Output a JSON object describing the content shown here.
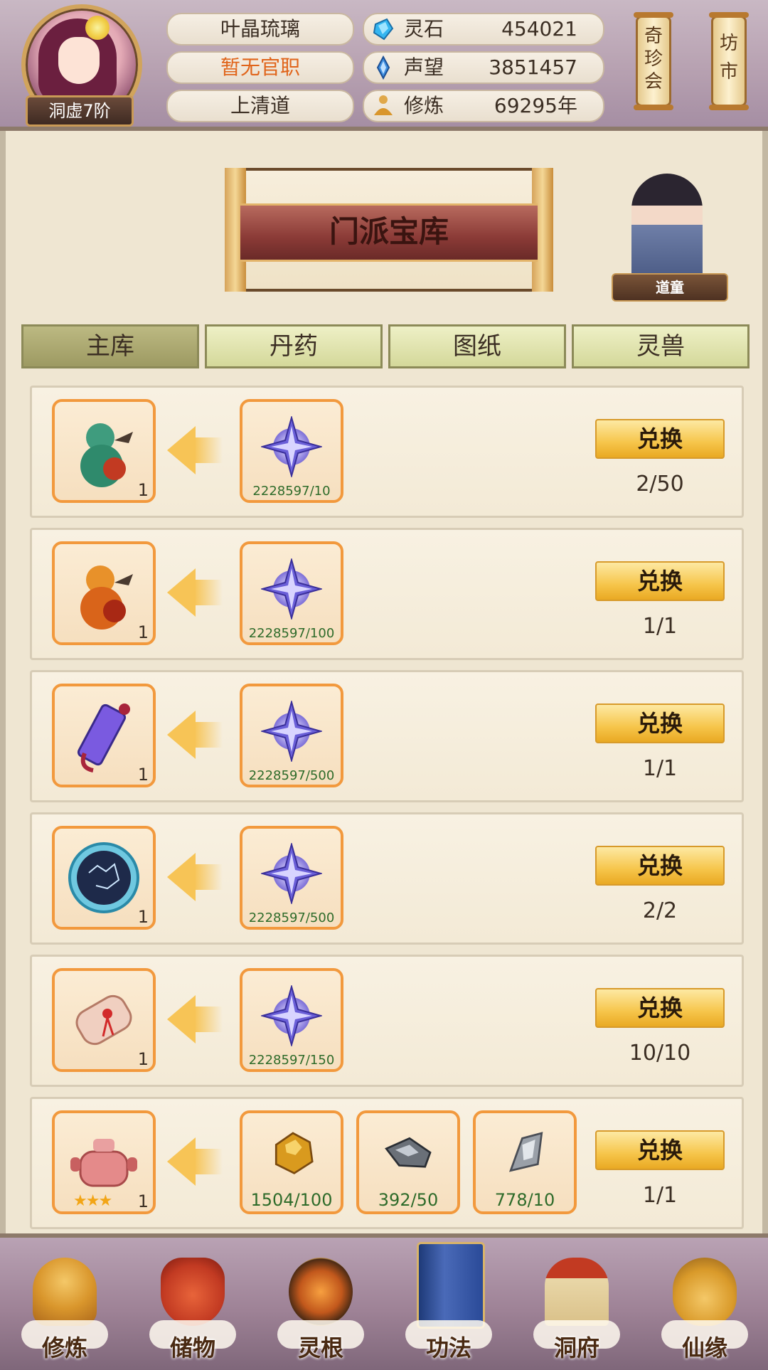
{
  "header": {
    "player_name": "叶晶琉璃",
    "official_title": "暂无官职",
    "sect": "上清道",
    "rank": "洞虚7阶",
    "stats": [
      {
        "label": "灵石",
        "value": "454021",
        "icon": "spirit-stone-icon",
        "color": "#2fa8e8"
      },
      {
        "label": "声望",
        "value": "3851457",
        "icon": "reputation-crystal-icon",
        "color": "#2a7fd0"
      },
      {
        "label": "修炼",
        "value": "69295年",
        "icon": "meditation-icon",
        "color": "#d9a040"
      }
    ],
    "side_buttons": [
      {
        "label": "奇珍会"
      },
      {
        "label": "坊市"
      }
    ]
  },
  "page": {
    "title": "门派宝库",
    "npc_name": "道童"
  },
  "tabs": [
    {
      "label": "主库",
      "active": true
    },
    {
      "label": "丹药",
      "active": false
    },
    {
      "label": "图纸",
      "active": false
    },
    {
      "label": "灵兽",
      "active": false
    }
  ],
  "exchange_rows": [
    {
      "reward": "green-gourd-icon",
      "reward_qty": "1",
      "costs": [
        {
          "icon": "sect-contribution-star-icon",
          "count": "2228597/10"
        }
      ],
      "button": "兑换",
      "limit": "2/50"
    },
    {
      "reward": "orange-gourd-icon",
      "reward_qty": "1",
      "costs": [
        {
          "icon": "sect-contribution-star-icon",
          "count": "2228597/100"
        }
      ],
      "button": "兑换",
      "limit": "1/1"
    },
    {
      "reward": "jade-talisman-icon",
      "reward_qty": "1",
      "costs": [
        {
          "icon": "sect-contribution-star-icon",
          "count": "2228597/500"
        }
      ],
      "button": "兑换",
      "limit": "1/1"
    },
    {
      "reward": "star-chart-disc-icon",
      "reward_qty": "1",
      "costs": [
        {
          "icon": "sect-contribution-star-icon",
          "count": "2228597/500"
        }
      ],
      "button": "兑换",
      "limit": "2/2"
    },
    {
      "reward": "scroll-icon",
      "reward_qty": "1",
      "costs": [
        {
          "icon": "sect-contribution-star-icon",
          "count": "2228597/150"
        }
      ],
      "button": "兑换",
      "limit": "10/10"
    },
    {
      "reward": "cauldron-icon",
      "reward_qty": "1",
      "reward_stars": 3,
      "costs": [
        {
          "icon": "gold-ore-icon",
          "count": "1504/100"
        },
        {
          "icon": "iron-ore-icon",
          "count": "392/50"
        },
        {
          "icon": "silver-ore-icon",
          "count": "778/10"
        }
      ],
      "button": "兑换",
      "limit": "1/1"
    }
  ],
  "bottom_nav": [
    {
      "label": "修炼",
      "icon": "meditating-monk-icon"
    },
    {
      "label": "储物",
      "icon": "storage-bag-icon"
    },
    {
      "label": "灵根",
      "icon": "spirit-root-orb-icon"
    },
    {
      "label": "功法",
      "icon": "technique-book-icon"
    },
    {
      "label": "洞府",
      "icon": "cave-dwelling-icon"
    },
    {
      "label": "仙缘",
      "icon": "immortal-gourd-icon"
    }
  ]
}
